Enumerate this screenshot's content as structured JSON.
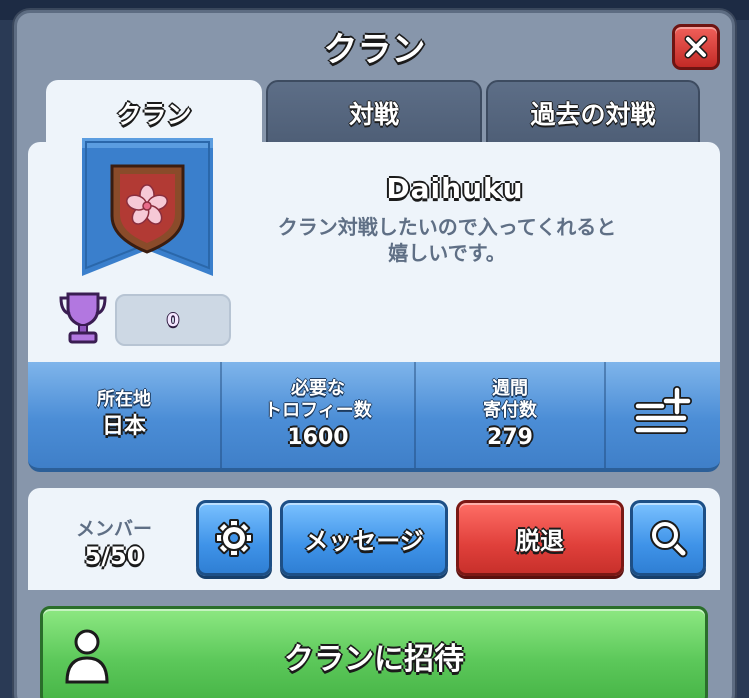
{
  "dialog": {
    "title": "クラン",
    "close_icon": "close-icon"
  },
  "tabs": [
    {
      "label": "クラン",
      "active": true
    },
    {
      "label": "対戦",
      "active": false
    },
    {
      "label": "過去の対戦",
      "active": false
    }
  ],
  "clan": {
    "badge_icon": "sakura-shield-icon",
    "name": "Daihuku",
    "description_line1": "クラン対戦したいので入ってくれると",
    "description_line2": "嬉しいです。",
    "trophy_icon": "trophy-icon",
    "trophy_value": "0"
  },
  "stats": {
    "location": {
      "label": "所在地",
      "value": "日本"
    },
    "required_trophies": {
      "label_line1": "必要な",
      "label_line2": "トロフィー数",
      "value": "1600"
    },
    "weekly_donations": {
      "label_line1": "週間",
      "label_line2": "寄付数",
      "value": "279"
    },
    "filter_icon": "list-plus-icon"
  },
  "members": {
    "label": "メンバー",
    "count": "5/50"
  },
  "actions": {
    "settings_icon": "gear-icon",
    "message_label": "メッセージ",
    "leave_label": "脱退",
    "search_icon": "search-icon"
  },
  "invite": {
    "label": "クランに招待",
    "icon": "person-icon"
  },
  "colors": {
    "panel": "#8796ab",
    "card": "#eef4fa",
    "stats_blue": "#4b8dd6",
    "button_blue": "#3f93e8",
    "button_red": "#e0403b",
    "button_green": "#5cc85a",
    "close_red": "#c22a26"
  }
}
